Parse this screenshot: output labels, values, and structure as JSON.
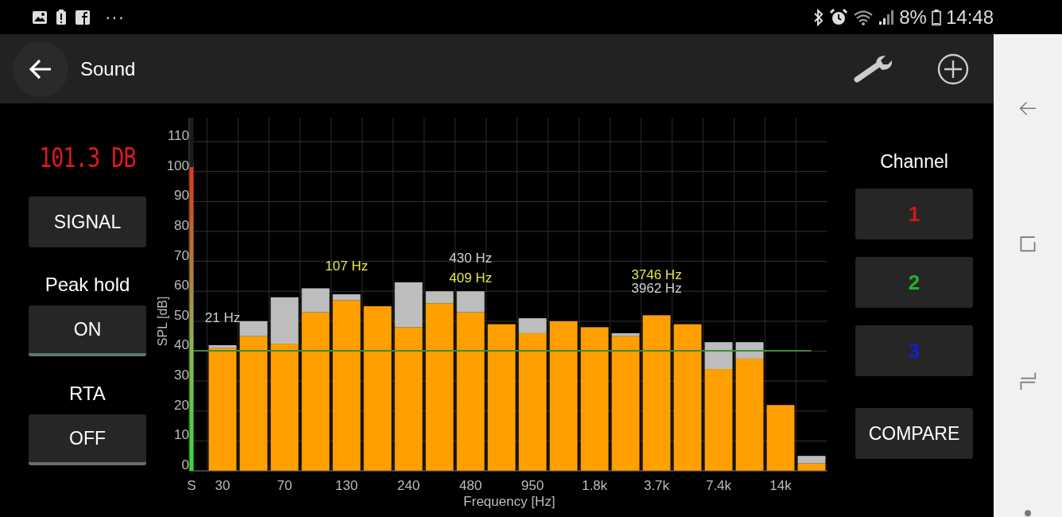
{
  "status_bar": {
    "more": "···",
    "battery": "8%",
    "time": "14:48"
  },
  "app_bar": {
    "title": "Sound"
  },
  "left_panel": {
    "readout": "101.3 DB",
    "signal_button": "SIGNAL",
    "toggles": [
      {
        "label": "Peak hold",
        "button": "ON",
        "on": true
      },
      {
        "label": "RTA",
        "button": "OFF",
        "on": false
      }
    ]
  },
  "chart": {
    "signal_meter": {
      "label": "S",
      "level": 0.86
    },
    "peak_labels": [
      {
        "text": "21 Hz",
        "color": "#cfcfcf"
      },
      {
        "text": "107 Hz",
        "color": "#e6e64a"
      },
      {
        "text": "430 Hz",
        "color": "#cfcfcf"
      },
      {
        "text": "409 Hz",
        "color": "#e6e64a"
      },
      {
        "text": "3746 Hz",
        "color": "#e6e64a"
      },
      {
        "text": "3962 Hz",
        "color": "#cfcfcf"
      }
    ],
    "chart_data": {
      "type": "bar",
      "xlabel": "Frequency [Hz]",
      "ylabel": "SPL [dB]",
      "stacked": true,
      "grid": true,
      "categories": [
        "30",
        null,
        "70",
        null,
        "130",
        null,
        "240",
        null,
        "480",
        null,
        "950",
        null,
        "1.8k",
        null,
        "3.7k",
        null,
        "7.4k",
        null,
        "14k",
        null
      ],
      "ylim": [
        0,
        118
      ],
      "yticks": [
        0,
        10,
        20,
        30,
        40,
        50,
        60,
        70,
        80,
        90,
        100,
        110
      ],
      "series": [
        {
          "color": "#ffa000",
          "values": [
            41,
            45,
            42.5,
            53,
            57,
            55,
            48,
            56,
            53,
            49,
            46,
            50,
            48,
            45,
            52,
            49,
            34,
            37.5,
            22,
            2.5
          ]
        },
        {
          "color": "#bdbdbd",
          "values": [
            1,
            5,
            15.5,
            8,
            2,
            0,
            15,
            4,
            7,
            0,
            5,
            0,
            0,
            1,
            0,
            0,
            9,
            5.5,
            0,
            2.5
          ]
        }
      ]
    }
  },
  "right_panel": {
    "title": "Channel",
    "channels": [
      {
        "label": "1",
        "color": "#d01818"
      },
      {
        "label": "2",
        "color": "#22b522"
      },
      {
        "label": "3",
        "color": "#1a1ad0"
      }
    ],
    "compare_button": "COMPARE"
  }
}
